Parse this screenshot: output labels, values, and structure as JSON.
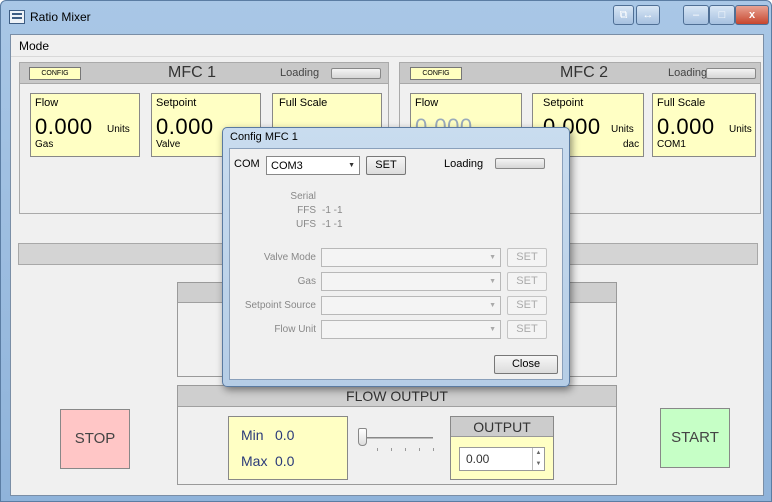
{
  "window": {
    "title": "Ratio Mixer",
    "controls": {
      "restore": "⧉",
      "swap": "↔",
      "minimize": "–",
      "maximize": "□",
      "close": "x"
    }
  },
  "menu": {
    "mode": "Mode"
  },
  "mfc1": {
    "config": "CONFIG",
    "title": "MFC 1",
    "loading": "Loading",
    "flow": {
      "label": "Flow",
      "value": "0.000",
      "unit": "Units",
      "sub": "Gas"
    },
    "setpoint": {
      "label": "Setpoint",
      "value": "0.000",
      "sub": "Valve"
    },
    "fullscale": {
      "label": "Full Scale"
    }
  },
  "mfc2": {
    "config": "CONFIG",
    "title": "MFC 2",
    "loading": "Loading",
    "flow": {
      "label": "Flow",
      "value": "0.000"
    },
    "setpoint": {
      "label": "Setpoint",
      "value": "0.000",
      "unit": "Units",
      "sub": "dac"
    },
    "fullscale": {
      "label": "Full Scale",
      "value": "0.000",
      "unit": "Units",
      "sub": "COM1"
    }
  },
  "dialog": {
    "title": "Config MFC 1",
    "com_label": "COM",
    "com_value": "COM3",
    "set": "SET",
    "loading": "Loading",
    "serial": "Serial",
    "ffs_label": "FFS",
    "ffs_value": "-1 -1",
    "ufs_label": "UFS",
    "ufs_value": "-1 -1",
    "rows": [
      {
        "label": "Valve Mode",
        "set": "SET"
      },
      {
        "label": "Gas",
        "set": "SET"
      },
      {
        "label": "Setpoint Source",
        "set": "SET"
      },
      {
        "label": "Flow Unit",
        "set": "SET"
      }
    ],
    "close": "Close"
  },
  "flow_output": {
    "title": "FLOW OUTPUT",
    "min_label": "Min",
    "min_value": "0.0",
    "max_label": "Max",
    "max_value": "0.0",
    "output_title": "OUTPUT",
    "output_value": "0.00"
  },
  "buttons": {
    "stop": "STOP",
    "start": "START"
  },
  "colors": {
    "card": "#ffffc4",
    "stop": "#ffc6c6",
    "start": "#c6ffc6"
  }
}
